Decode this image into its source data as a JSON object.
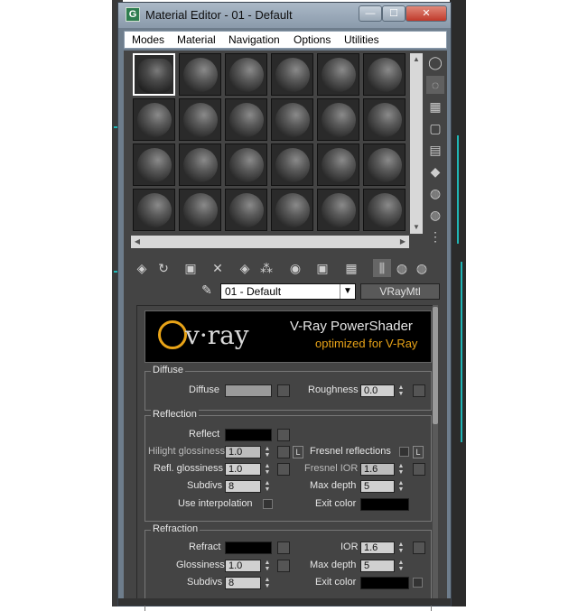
{
  "window": {
    "title": "Material Editor - 01 - Default",
    "app_icon": "3ds-max-icon",
    "controls": {
      "minimize": "—",
      "maximize": "☐",
      "close": "✕"
    }
  },
  "menu": [
    "Modes",
    "Material",
    "Navigation",
    "Options",
    "Utilities"
  ],
  "toolbar": {
    "material_name": "01 - Default",
    "material_type": "VRayMtl"
  },
  "banner": {
    "logo_text": "v·ray",
    "title": "V-Ray PowerShader",
    "subtitle": "optimized for V-Ray"
  },
  "diffuse": {
    "group_title": "Diffuse",
    "diffuse_label": "Diffuse",
    "roughness_label": "Roughness",
    "roughness_value": "0.0",
    "diffuse_color": "#9a9a9a"
  },
  "reflection": {
    "group_title": "Reflection",
    "reflect_label": "Reflect",
    "reflect_color": "#000000",
    "hilight_label": "Hilight glossiness",
    "hilight_value": "1.0",
    "lock_L": "L",
    "fresnel_label": "Fresnel reflections",
    "refl_gloss_label": "Refl. glossiness",
    "refl_gloss_value": "1.0",
    "fresnel_ior_label": "Fresnel IOR",
    "fresnel_ior_value": "1.6",
    "subdivs_label": "Subdivs",
    "subdivs_value": "8",
    "max_depth_label": "Max depth",
    "max_depth_value": "5",
    "use_interp_label": "Use interpolation",
    "exit_color_label": "Exit color",
    "exit_color": "#000000"
  },
  "refraction": {
    "group_title": "Refraction",
    "refract_label": "Refract",
    "refract_color": "#000000",
    "ior_label": "IOR",
    "ior_value": "1.6",
    "gloss_label": "Glossiness",
    "gloss_value": "1.0",
    "max_depth_label": "Max depth",
    "max_depth_value": "5",
    "subdivs_label": "Subdivs",
    "subdivs_value": "8",
    "exit_color_label": "Exit color",
    "exit_color": "#000000"
  }
}
